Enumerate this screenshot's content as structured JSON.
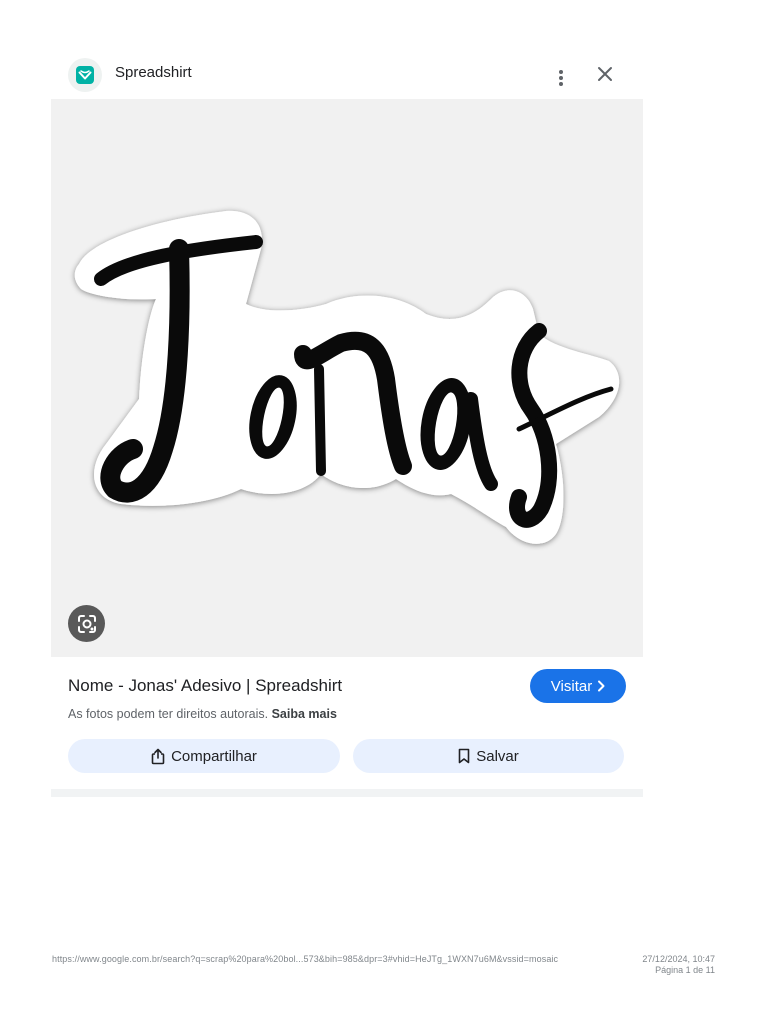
{
  "header": {
    "site_name": "Spreadshirt",
    "site_icon": "spreadshirt-heart-icon",
    "accent_color": "#00b2a5"
  },
  "image": {
    "text": "Jonas",
    "lens_icon": "google-lens-icon"
  },
  "result": {
    "title": "Nome - Jonas' Adesivo | Spreadshirt",
    "visit_label": "Visitar",
    "copyright_text": "As fotos podem ter direitos autorais.",
    "learn_more": "Saiba mais"
  },
  "actions": {
    "share_label": "Compartilhar",
    "save_label": "Salvar"
  },
  "footer": {
    "url": "https://www.google.com.br/search?q=scrap%20para%20bol...573&bih=985&dpr=3#vhid=HeJTg_1WXN7u6M&vssid=mosaic",
    "datetime": "27/12/2024, 10:47",
    "page": "Página 1 de 11"
  },
  "colors": {
    "primary": "#1a73e8",
    "tonal_button": "#e8f0fe"
  }
}
